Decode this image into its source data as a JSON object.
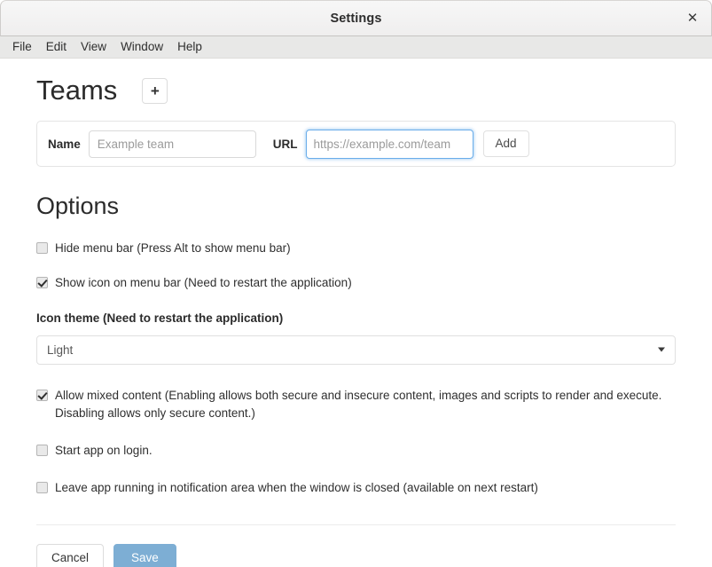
{
  "window": {
    "title": "Settings",
    "close_icon": "close-icon",
    "close_glyph": "✕"
  },
  "menu_bar": {
    "items": [
      {
        "label": "File"
      },
      {
        "label": "Edit"
      },
      {
        "label": "View"
      },
      {
        "label": "Window"
      },
      {
        "label": "Help"
      }
    ]
  },
  "teams": {
    "title": "Teams",
    "add_team_icon": "plus-icon",
    "add_team_glyph": "+",
    "form": {
      "name_label": "Name",
      "name_value": "",
      "name_placeholder": "Example team",
      "url_label": "URL",
      "url_value": "",
      "url_placeholder": "https://example.com/team",
      "add_label": "Add"
    }
  },
  "options": {
    "title": "Options",
    "hide_menu_bar": {
      "label": "Hide menu bar (Press Alt to show menu bar)",
      "checked": false
    },
    "show_icon_on_menu_bar": {
      "label": "Show icon on menu bar (Need to restart the application)",
      "checked": true
    },
    "icon_theme": {
      "label": "Icon theme (Need to restart the application)",
      "selected": "Light",
      "arrow_icon": "chevron-down-icon"
    },
    "allow_mixed_content": {
      "label": "Allow mixed content (Enabling allows both secure and insecure content, images and scripts to render and execute. Disabling allows only secure content.)",
      "checked": true
    },
    "start_app_on_login": {
      "label": "Start app on login.",
      "checked": false
    },
    "leave_app_running": {
      "label": "Leave app running in notification area when the window is closed (available on next restart)",
      "checked": false
    }
  },
  "footer": {
    "cancel_label": "Cancel",
    "save_label": "Save",
    "save_color": "#7daed4"
  }
}
